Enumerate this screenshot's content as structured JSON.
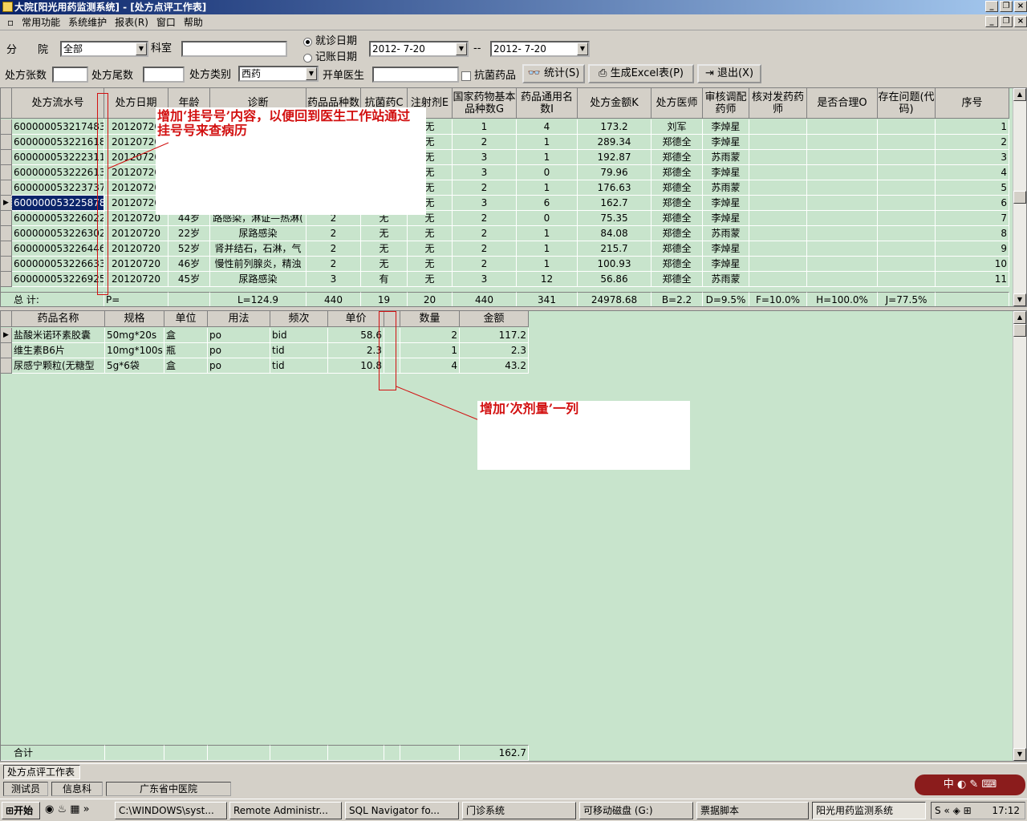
{
  "window": {
    "title": "大院[阳光用药监测系统] - [处方点评工作表]"
  },
  "menu": {
    "items": [
      "常用功能",
      "系统维护",
      "报表(R)",
      "窗口",
      "帮助"
    ]
  },
  "filters": {
    "branch_label": "分　　院",
    "branch_value": "全部",
    "dept_label": "科室",
    "dept_value": "",
    "radio_visit": "就诊日期",
    "radio_account": "记账日期",
    "date_from": "2012- 7-20",
    "date_sep": "--",
    "date_to": "2012- 7-20",
    "count_label": "处方张数",
    "tail_label": "处方尾数",
    "type_label": "处方类别",
    "type_value": "西药",
    "doctor_label": "开单医生",
    "antibiotic_label": "抗菌药品",
    "btn_stats": "统计(S)",
    "btn_excel": "生成Excel表(P)",
    "btn_exit": "退出(X)"
  },
  "rx_grid": {
    "headers": [
      "处方流水号",
      "处方日期",
      "年龄",
      "诊断",
      "药品品种数",
      "抗菌药C",
      "注射剂E",
      "国家药物基本品种数G",
      "药品通用名数I",
      "处方金额K",
      "处方医师",
      "审核调配药师",
      "核对发药药师",
      "是否合理O",
      "存在问题(代码)",
      "序号"
    ],
    "rows": [
      [
        "600000053217483",
        "20120720",
        "",
        "",
        "",
        "",
        "无",
        "1",
        "4",
        "173.2",
        "刘军",
        "李焯星",
        "",
        "",
        "",
        "1"
      ],
      [
        "600000053221618",
        "20120720",
        "",
        "",
        "",
        "",
        "无",
        "2",
        "1",
        "289.34",
        "郑德全",
        "李焯星",
        "",
        "",
        "",
        "2"
      ],
      [
        "600000053222311",
        "20120720",
        "",
        "",
        "",
        "",
        "无",
        "3",
        "1",
        "192.87",
        "郑德全",
        "苏雨蒙",
        "",
        "",
        "",
        "3"
      ],
      [
        "600000053222613",
        "20120720",
        "",
        "",
        "",
        "",
        "无",
        "3",
        "0",
        "79.96",
        "郑德全",
        "李焯星",
        "",
        "",
        "",
        "4"
      ],
      [
        "600000053223737",
        "20120720",
        "",
        "",
        "",
        "",
        "无",
        "2",
        "1",
        "176.63",
        "郑德全",
        "苏雨蒙",
        "",
        "",
        "",
        "5"
      ],
      [
        "600000053225878",
        "20120720",
        "",
        "",
        "",
        "",
        "无",
        "3",
        "6",
        "162.7",
        "郑德全",
        "李焯星",
        "",
        "",
        "",
        "6"
      ],
      [
        "600000053226022",
        "20120720",
        "44岁",
        "路感染，淋证—热淋(",
        "2",
        "无",
        "无",
        "2",
        "0",
        "75.35",
        "郑德全",
        "李焯星",
        "",
        "",
        "",
        "7"
      ],
      [
        "600000053226302",
        "20120720",
        "22岁",
        "尿路感染",
        "2",
        "无",
        "无",
        "2",
        "1",
        "84.08",
        "郑德全",
        "苏雨蒙",
        "",
        "",
        "",
        "8"
      ],
      [
        "600000053226446",
        "20120720",
        "52岁",
        "肾并结石，石淋，气",
        "2",
        "无",
        "无",
        "2",
        "1",
        "215.7",
        "郑德全",
        "李焯星",
        "",
        "",
        "",
        "9"
      ],
      [
        "600000053226633",
        "20120720",
        "46岁",
        "慢性前列腺炎，精浊",
        "2",
        "无",
        "无",
        "2",
        "1",
        "100.93",
        "郑德全",
        "李焯星",
        "",
        "",
        "",
        "10"
      ],
      [
        "600000053226925",
        "20120720",
        "45岁",
        "尿路感染",
        "3",
        "有",
        "无",
        "3",
        "12",
        "56.86",
        "郑德全",
        "苏雨蒙",
        "",
        "",
        "",
        "11"
      ]
    ],
    "totals": [
      "总 计:",
      "P=",
      "",
      "L=124.9",
      "440",
      "19",
      "20",
      "440",
      "341",
      "24978.68",
      "B=2.2",
      "D=9.5%",
      "F=10.0%",
      "H=100.0%",
      "J=77.5%",
      ""
    ]
  },
  "drug_grid": {
    "headers": [
      "药品名称",
      "规格",
      "单位",
      "用法",
      "频次",
      "单价",
      "",
      "数量",
      "金额"
    ],
    "rows": [
      [
        "盐酸米诺环素胶囊",
        "50mg*20s",
        "盒",
        "po",
        "bid",
        "58.6",
        "",
        "2",
        "117.2"
      ],
      [
        "维生素B6片",
        "10mg*100s",
        "瓶",
        "po",
        "tid",
        "2.3",
        "",
        "1",
        "2.3"
      ],
      [
        "尿感宁颗粒(无糖型",
        "5g*6袋",
        "盒",
        "po",
        "tid",
        "10.8",
        "",
        "4",
        "43.2"
      ]
    ],
    "total_label": "合计",
    "total_value": "162.7"
  },
  "annotations": {
    "note1": "增加‘挂号号’内容，以便回到医生工作站通过挂号号来查病历",
    "note2": "增加‘次剂量’一列"
  },
  "mdi_tab": "处方点评工作表",
  "status": {
    "role": "测试员",
    "dept": "信息科",
    "hospital": "广东省中医院"
  },
  "taskbar": {
    "start": "开始",
    "tasks": [
      "C:\\WINDOWS\\syst...",
      "Remote Administr...",
      "SQL Navigator fo...",
      "门诊系统",
      "可移动磁盘 (G:)",
      "票据脚本",
      "阳光用药监测系统"
    ],
    "ime": "中",
    "clock": "17:12"
  },
  "colors": {
    "grid_bg": "#c8e4cc",
    "title_start": "#0a246a",
    "title_end": "#a6caf0",
    "annotation_red": "#d21010"
  }
}
